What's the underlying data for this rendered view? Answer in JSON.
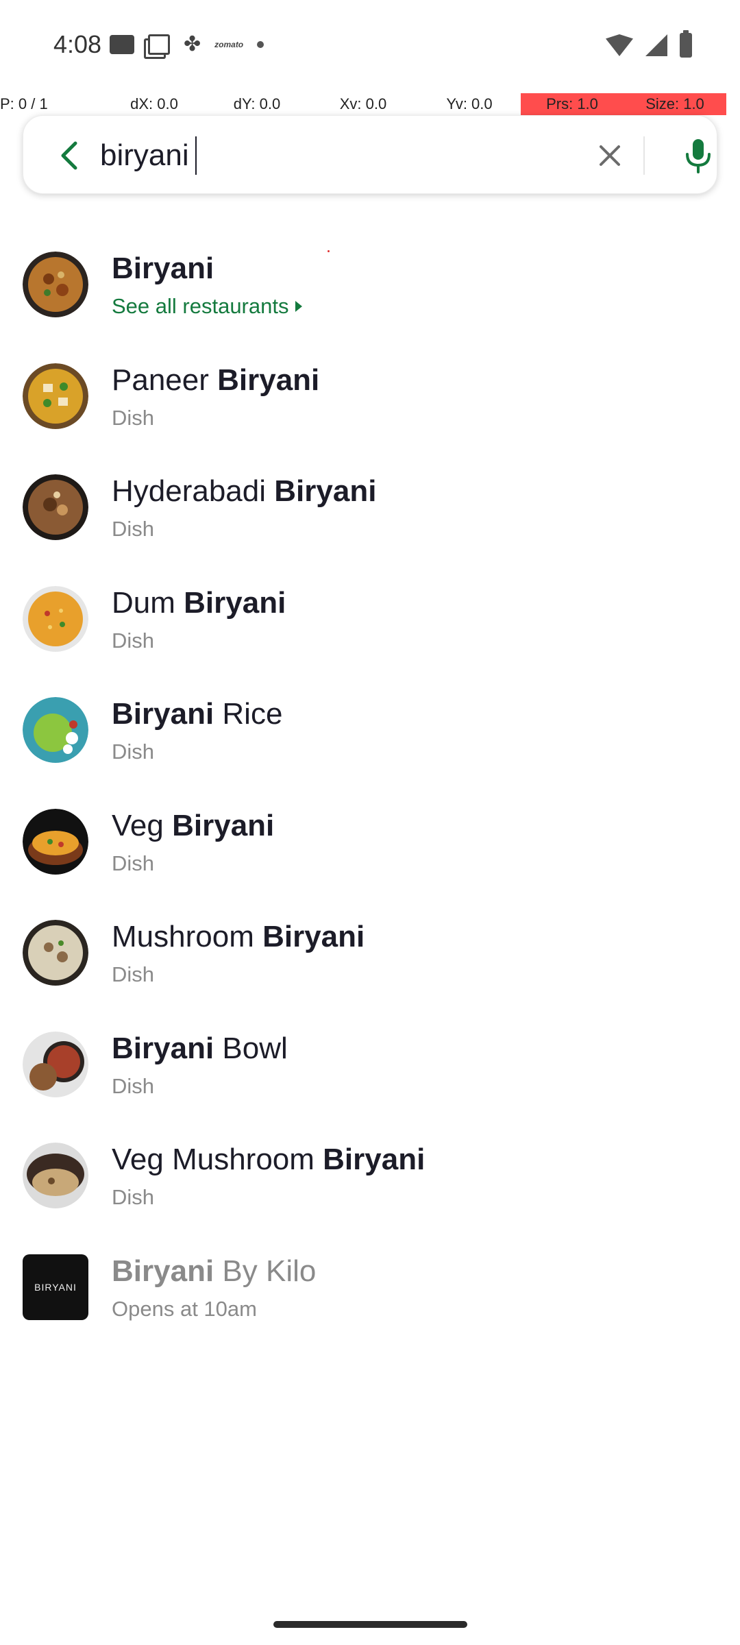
{
  "status_bar": {
    "time": "4:08",
    "brand_text": "zomato",
    "left_icons": [
      "media-icon",
      "copy-icon",
      "pinwheel-icon",
      "zomato-icon",
      "dot-icon"
    ],
    "right_icons": [
      "wifi-icon",
      "signal-icon",
      "battery-icon"
    ]
  },
  "debug": {
    "p": "P: 0 / 1",
    "dx": "dX: 0.0",
    "dy": "dY: 0.0",
    "xv": "Xv: 0.0",
    "yv": "Yv: 0.0",
    "prs": "Prs: 1.0",
    "size": "Size: 1.0",
    "highlight_color": "#ff4d4d"
  },
  "search": {
    "value": "biryani",
    "back_icon": "back-arrow-icon",
    "clear_icon": "close-icon",
    "mic_icon": "mic-icon",
    "accent_color": "#147a3e"
  },
  "results": [
    {
      "pre": "",
      "bold": "Biryani",
      "post": "",
      "subtitle": "See all restaurants",
      "type": "link"
    },
    {
      "pre": "Paneer ",
      "bold": "Biryani",
      "post": "",
      "subtitle": "Dish",
      "type": "dish"
    },
    {
      "pre": "Hyderabadi ",
      "bold": "Biryani",
      "post": "",
      "subtitle": "Dish",
      "type": "dish"
    },
    {
      "pre": "Dum ",
      "bold": "Biryani",
      "post": "",
      "subtitle": "Dish",
      "type": "dish"
    },
    {
      "pre": "",
      "bold": "Biryani",
      "post": " Rice",
      "subtitle": "Dish",
      "type": "dish"
    },
    {
      "pre": "Veg ",
      "bold": "Biryani",
      "post": "",
      "subtitle": "Dish",
      "type": "dish"
    },
    {
      "pre": "Mushroom ",
      "bold": "Biryani",
      "post": "",
      "subtitle": "Dish",
      "type": "dish"
    },
    {
      "pre": "",
      "bold": "Biryani",
      "post": " Bowl",
      "subtitle": "Dish",
      "type": "dish"
    },
    {
      "pre": "Veg Mushroom ",
      "bold": "Biryani",
      "post": "",
      "subtitle": "Dish",
      "type": "dish"
    },
    {
      "pre": "",
      "bold": "Biryani",
      "post": " By Kilo",
      "subtitle": "Opens at 10am",
      "type": "restaurant",
      "logo_text": "BIRYANI"
    }
  ]
}
